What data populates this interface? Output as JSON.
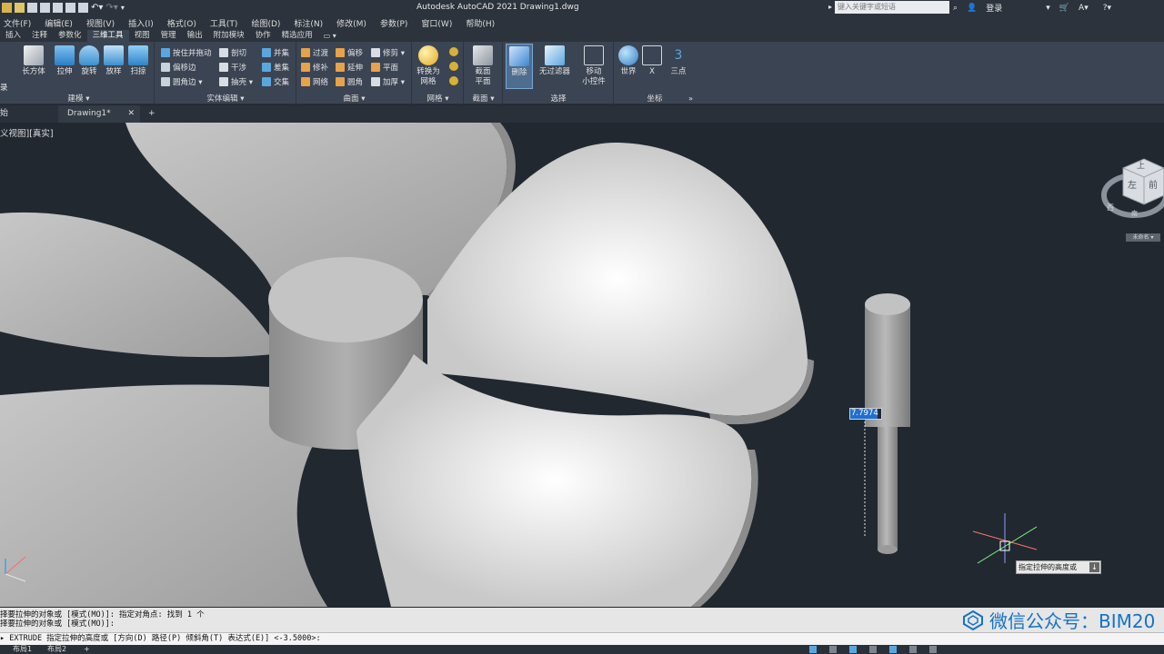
{
  "app": {
    "title": "Autodesk AutoCAD 2021    Drawing1.dwg",
    "search_placeholder": "键入关键字或短语",
    "login_label": "登录"
  },
  "menu": [
    "文件(F)",
    "编辑(E)",
    "视图(V)",
    "插入(I)",
    "格式(O)",
    "工具(T)",
    "绘图(D)",
    "标注(N)",
    "修改(M)",
    "参数(P)",
    "窗口(W)",
    "帮助(H)"
  ],
  "ribbon_tabs": [
    "插入",
    "注释",
    "参数化",
    "三维工具",
    "视图",
    "管理",
    "输出",
    "附加模块",
    "协作",
    "精选应用"
  ],
  "ribbon_active_tab": "三维工具",
  "ribbon": {
    "modeling": {
      "label": "建模 ▾",
      "buttons": [
        "长方体",
        "拉伸",
        "旋转",
        "放样",
        "扫掠"
      ]
    },
    "solid_edit": {
      "label": "实体编辑 ▾",
      "col1": [
        "按住并拖动",
        "偏移边",
        "圆角边 ▾"
      ],
      "col2": [
        "剖切",
        "干涉",
        "抽壳 ▾"
      ],
      "col3": [
        "并集",
        "差集",
        "交集"
      ]
    },
    "surface": {
      "label": "曲面 ▾",
      "col1": [
        "过渡",
        "修补",
        "网络"
      ],
      "col2": [
        "偏移",
        "延伸",
        "圆角"
      ],
      "col3": [
        "修剪 ▾",
        "平面",
        "加厚 ▾"
      ]
    },
    "mesh": {
      "label": "网格 ▾",
      "button": "转换为\n网格"
    },
    "section": {
      "label": "截面 ▾",
      "button": "截面\n平面"
    },
    "selection": {
      "label": "选择",
      "buttons": [
        "删除",
        "无过滤器",
        "移动\n小控件"
      ]
    },
    "coords": {
      "label": "坐标",
      "buttons": [
        "世界",
        "X",
        "三点"
      ],
      "three_label": "3"
    },
    "left_cut_label": "录"
  },
  "file_tabs": {
    "start": "始",
    "drawing": "Drawing1*",
    "close": "✕",
    "add": "+"
  },
  "viewport": {
    "label": "义视图][真实]",
    "viewcube_top": "上",
    "viewcube_front": "前",
    "viewcube_left": "左",
    "compass_w": "西",
    "compass_s": "南",
    "wcs_label": "未命名 ▾"
  },
  "dynamic_input": {
    "value": "7.7974"
  },
  "tooltip": {
    "text": "指定拉伸的高度或",
    "icon": "↓"
  },
  "command_history": [
    "择要拉伸的对象或 [模式(MO)]: 指定对角点: 找到 1 个",
    "择要拉伸的对象或 [模式(MO)]:"
  ],
  "command_line": "▸ EXTRUDE 指定拉伸的高度或 [方向(D) 路径(P) 倾斜角(T) 表达式(E)] <-3.5000>:",
  "layout_tabs": [
    "布局1",
    "布局2",
    "+"
  ],
  "watermark": "微信公众号：BIM20",
  "colors": {
    "ribbon": "#3b4453",
    "viewport": "#212830",
    "accent": "#1f6fd1"
  }
}
